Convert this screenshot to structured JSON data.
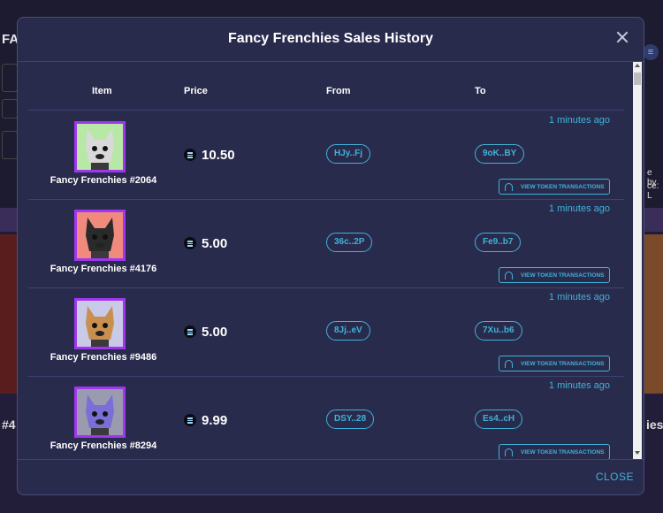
{
  "background": {
    "app_title_fragment": "FA",
    "right_fragment_1": "e by",
    "right_fragment_2": "ce: L",
    "left_fragment_bottom": "#4",
    "right_fragment_bottom": "ies"
  },
  "modal": {
    "title": "Fancy Frenchies Sales History",
    "footer_close": "CLOSE"
  },
  "table": {
    "headers": {
      "item": "Item",
      "price": "Price",
      "from": "From",
      "to": "To"
    },
    "rows": [
      {
        "name": "Fancy Frenchies #2064",
        "price": "10.50",
        "from": "HJy..Fj",
        "to": "9oK..BY",
        "time": "1 minutes ago",
        "action": "VIEW TOKEN TRANSACTIONS",
        "thumb_bg": "#b7e8a6",
        "dog_color": "#d9d9d9"
      },
      {
        "name": "Fancy Frenchies #4176",
        "price": "5.00",
        "from": "36c..2P",
        "to": "Fe9..b7",
        "time": "1 minutes ago",
        "action": "VIEW TOKEN TRANSACTIONS",
        "thumb_bg": "#f08a7c",
        "dog_color": "#2a2a2a"
      },
      {
        "name": "Fancy Frenchies #9486",
        "price": "5.00",
        "from": "8Jj..eV",
        "to": "7Xu..b6",
        "time": "1 minutes ago",
        "action": "VIEW TOKEN TRANSACTIONS",
        "thumb_bg": "#c9c9e8",
        "dog_color": "#c98f4e"
      },
      {
        "name": "Fancy Frenchies #8294",
        "price": "9.99",
        "from": "DSY..28",
        "to": "Es4..cH",
        "time": "1 minutes ago",
        "action": "VIEW TOKEN TRANSACTIONS",
        "thumb_bg": "#9b9bb0",
        "dog_color": "#7a6fd6"
      }
    ]
  },
  "colors": {
    "accent": "#3fb3d8",
    "thumb_border": "#a135f0",
    "modal_bg": "#292b4d"
  }
}
